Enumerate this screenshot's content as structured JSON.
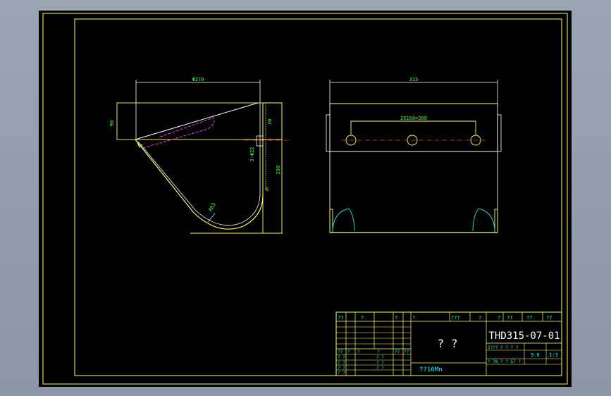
{
  "colors": {
    "frame": "#ffff66",
    "geometry": "#ffffff",
    "dimension": "#44ff44",
    "hidden": "#ff44ff",
    "arc": "#33cccc",
    "centerline": "#ff3333",
    "title_text": "#00ffff"
  },
  "front_view": {
    "dim_width": "Φ270",
    "dim_height_left": "90",
    "dim_height_right_top": "30",
    "dim_holes": "3-Φ22",
    "dim_overall_height": "280",
    "dim_radius": "R83",
    "dim_thickness": "6"
  },
  "side_view": {
    "dim_width": "315",
    "dim_hole_spacing": "2X100=200"
  },
  "title_block": {
    "header_row": [
      "??",
      "?",
      "?",
      "?",
      "???",
      "?",
      "?",
      "??",
      "??",
      "??"
    ],
    "part_name": "? ?",
    "drawing_number": "THD315-07-01",
    "material": "??16Mn",
    "sign_labels": [
      "??",
      "?",
      "?",
      "?",
      "??",
      "??"
    ],
    "approval_rows": [
      "? ?",
      "? ?",
      "? ?",
      "? ?"
    ],
    "approval_rows_mid": [
      "? ?",
      "? ?",
      "? ?"
    ],
    "scale_header": "1???  ?  ?  ?  ?",
    "weight": "9.6",
    "scale": "1:3",
    "sheet_info": "?  78  ?  ?  57  ?"
  }
}
